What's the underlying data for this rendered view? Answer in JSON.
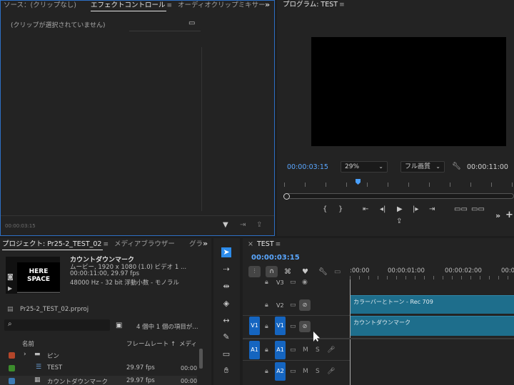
{
  "source_panel": {
    "tab_source": "ソース：(クリップなし)",
    "tab_effect": "エフェクトコントロール",
    "tab_audio_mixer": "オーディオクリップミキサー",
    "no_clip_msg": "(クリップが選択されていません)",
    "timecode": "00:00:03:15"
  },
  "program": {
    "tab_title": "プログラム: TEST",
    "timecode": "00:00:03:15",
    "zoom": "29%",
    "quality": "フル画質",
    "duration": "00:00:11:00",
    "playhead_fraction": 0.31
  },
  "project": {
    "tab_project": "プロジェクト: Pr25-2_TEST_02",
    "tab_media_browser": "メディアブラウザー",
    "tab_more": "グラ",
    "thumb_text_1": "HERE",
    "thumb_text_2": "SPACE",
    "clip_name": "カウントダウンマーク",
    "clip_info1": "ムービー, 1920 x 1080 (1.0)  ビデオ 1 ...",
    "clip_info2": "00:00:11:00, 29.97 fps",
    "clip_info3": "48000 Hz - 32 bit 浮動小数 - モノラル",
    "file_name": "Pr25-2_TEST_02.prproj",
    "count_text": "4 個中 1 個の項目が...",
    "col_name": "名前",
    "col_framerate": "フレームレート",
    "col_media": "メディ",
    "rows": [
      {
        "name": "ピン",
        "fps": "",
        "start": "",
        "color": "#b4462a"
      },
      {
        "name": "TEST",
        "fps": "29.97 fps",
        "start": "00:00",
        "color": "#3c8c2c"
      },
      {
        "name": "カウントダウンマーク",
        "fps": "29.97 fps",
        "start": "00:00",
        "color": "#3c7ab4"
      }
    ]
  },
  "timeline": {
    "tab_title": "TEST",
    "timecode": "00:00:03:15",
    "ruler_labels": [
      ":00:00",
      "00:00:01:00",
      "00:00:02:00",
      "00:0"
    ],
    "tracks": [
      {
        "label": "V3"
      },
      {
        "label": "V2"
      },
      {
        "label": "V1",
        "source": "V1"
      },
      {
        "label": "A1",
        "source": "A1"
      },
      {
        "label": "A2"
      }
    ],
    "clips": {
      "v2": "カラーバーとトーン - Rec 709",
      "v1": "カウントダウンマーク"
    }
  },
  "colors": {
    "accent": "#2d8ceb",
    "clip_video": "#1e6e8c",
    "track_target": "#1565c0"
  }
}
